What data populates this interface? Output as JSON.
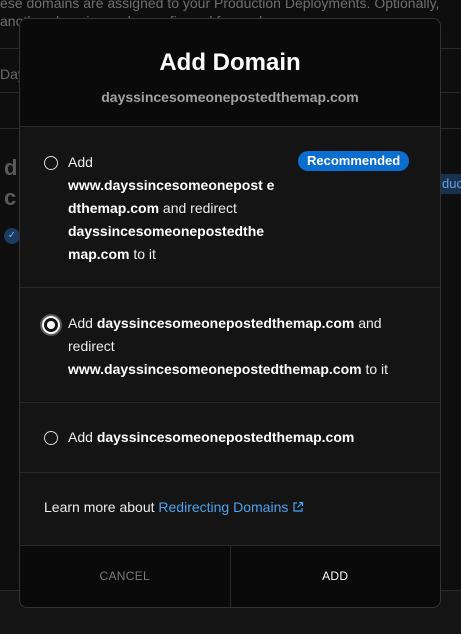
{
  "background": {
    "top_line1": "ese domains are assigned to your Production Deployments. Optionally,",
    "top_line2": "another domain can be configured for each one.",
    "row_label": "Day",
    "big_char1": "d",
    "big_char2": "c",
    "right_badge": "duc",
    "left_pill": "✓"
  },
  "modal": {
    "title": "Add Domain",
    "subtitle": "dayssincesomeonepostedthemap.com",
    "recommended_badge": "Recommended",
    "options": [
      {
        "add": "Add",
        "domain": "www.dayssincesomeonepost edthemap.com",
        "and_redirect": " and redirect ",
        "target": "dayssincesomeonepostedthe map.com",
        "to_it": " to it",
        "selected": false
      },
      {
        "add": "Add ",
        "domain": "dayssincesomeonepostedthemap.com",
        "and_redirect": " and redirect ",
        "target": "www.dayssincesomeonepostedthemap.com",
        "to_it": " to it",
        "selected": true
      },
      {
        "add": "Add ",
        "domain": "dayssincesomeonepostedthemap.com",
        "selected": false
      }
    ],
    "learn_more_prefix": "Learn more about ",
    "learn_more_link": "Redirecting Domains",
    "cancel_label": "CANCEL",
    "add_label": "ADD"
  },
  "colors": {
    "accent": "#0a6ed1",
    "link": "#4aa3f0"
  }
}
